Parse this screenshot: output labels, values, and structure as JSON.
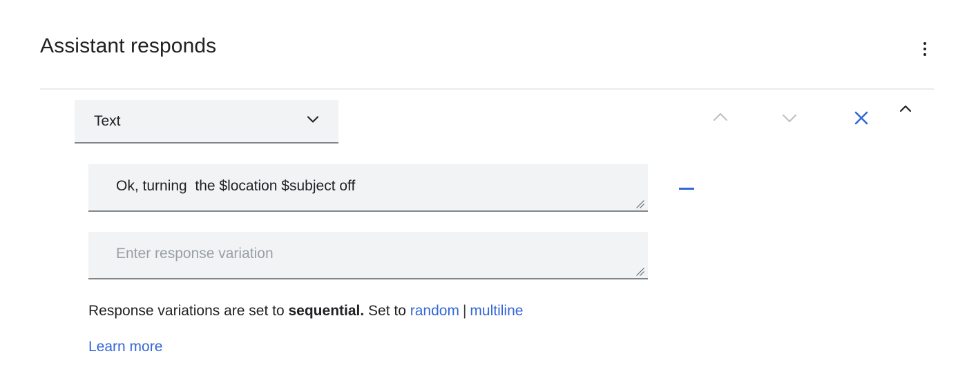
{
  "header": {
    "title": "Assistant responds",
    "overflow_menu_icon": "more-vert-icon"
  },
  "response_block": {
    "type_select": {
      "value": "Text",
      "chevron_icon": "chevron-down-icon"
    },
    "actions": {
      "move_up_icon": "chevron-up-icon",
      "move_down_icon": "chevron-down-icon",
      "close_icon": "close-x-icon",
      "collapse_icon": "chevron-up-icon"
    },
    "variations": [
      {
        "value": "Ok, turning  the $location $subject off",
        "placeholder": "Enter response variation",
        "remove_icon": "minus-icon",
        "resize_icon": "resize-grip-icon",
        "has_remove": true
      },
      {
        "value": "",
        "placeholder": "Enter response variation",
        "resize_icon": "resize-grip-icon",
        "has_remove": false
      }
    ],
    "mode_text": {
      "prefix": "Response variations are set to ",
      "current_mode": "sequential.",
      "middle": " Set to ",
      "link_random": "random",
      "separator": "|",
      "link_multiline": "multiline"
    },
    "learn_more_label": "Learn more"
  },
  "colors": {
    "link_blue": "#3367d6",
    "field_background": "#f1f3f4",
    "field_underline": "#80868b",
    "divider": "#e8eaed",
    "text_primary": "#202124",
    "placeholder": "#9aa0a6",
    "icon_muted": "#bdc1c6"
  }
}
